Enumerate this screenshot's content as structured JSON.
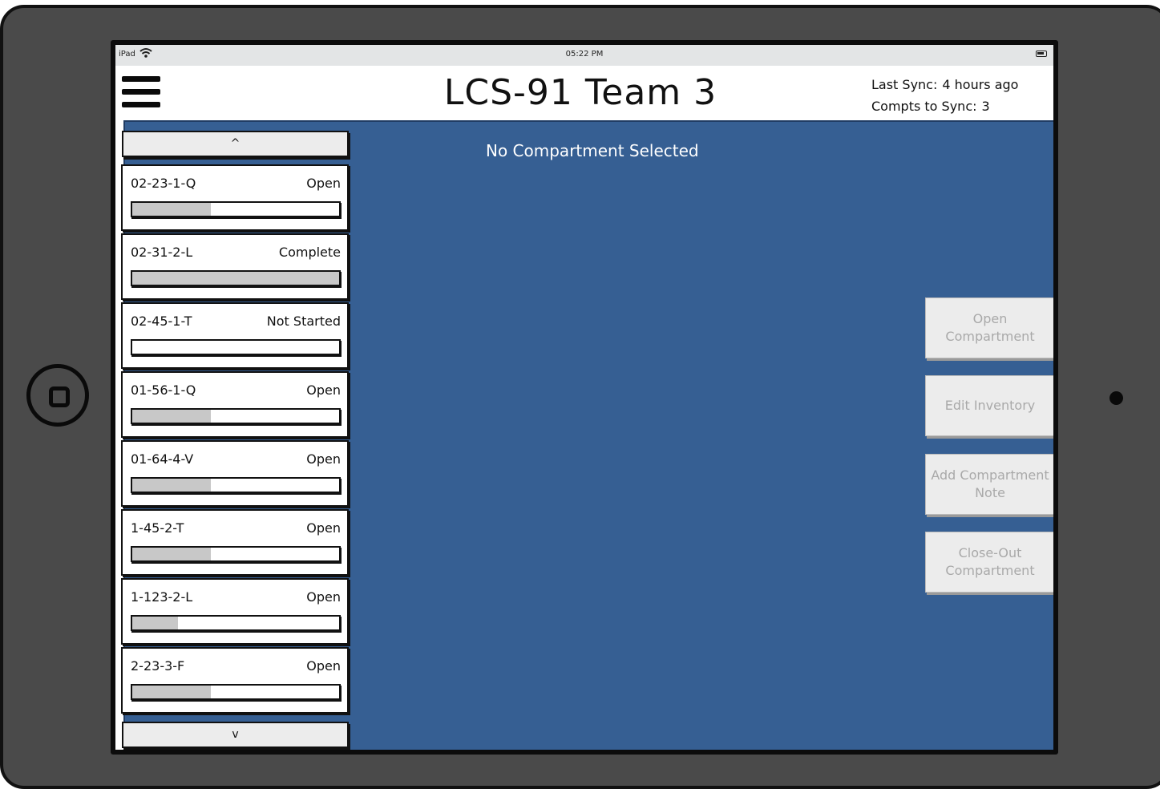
{
  "status_bar": {
    "carrier": "iPad",
    "time": "05:22 PM"
  },
  "header": {
    "title": "LCS-91  Team 3",
    "last_sync_label": "Last Sync:",
    "last_sync_value": "4 hours ago",
    "compts_to_sync_label": "Compts to Sync:",
    "compts_to_sync_value": "3"
  },
  "main": {
    "panel_title": "No Compartment Selected"
  },
  "list": {
    "scroll_up_label": "^",
    "scroll_down_label": "v",
    "compartments": [
      {
        "id": "02-23-1-Q",
        "status": "Open",
        "progress": 0.38
      },
      {
        "id": "02-31-2-L",
        "status": "Complete",
        "progress": 1.0
      },
      {
        "id": "02-45-1-T",
        "status": "Not Started",
        "progress": 0.0
      },
      {
        "id": "01-56-1-Q",
        "status": "Open",
        "progress": 0.38
      },
      {
        "id": "01-64-4-V",
        "status": "Open",
        "progress": 0.38
      },
      {
        "id": "1-45-2-T",
        "status": "Open",
        "progress": 0.38
      },
      {
        "id": "1-123-2-L",
        "status": "Open",
        "progress": 0.22
      },
      {
        "id": "2-23-3-F",
        "status": "Open",
        "progress": 0.38
      }
    ]
  },
  "actions": {
    "open_compartment": "Open Compartment",
    "edit_inventory": "Edit Inventory",
    "add_note": "Add Compartment Note",
    "close_out": "Close-Out Compartment"
  },
  "colors": {
    "panel_background": "#365f93",
    "progress_fill": "#c8c8c8",
    "disabled_text": "#a9a9a9"
  }
}
